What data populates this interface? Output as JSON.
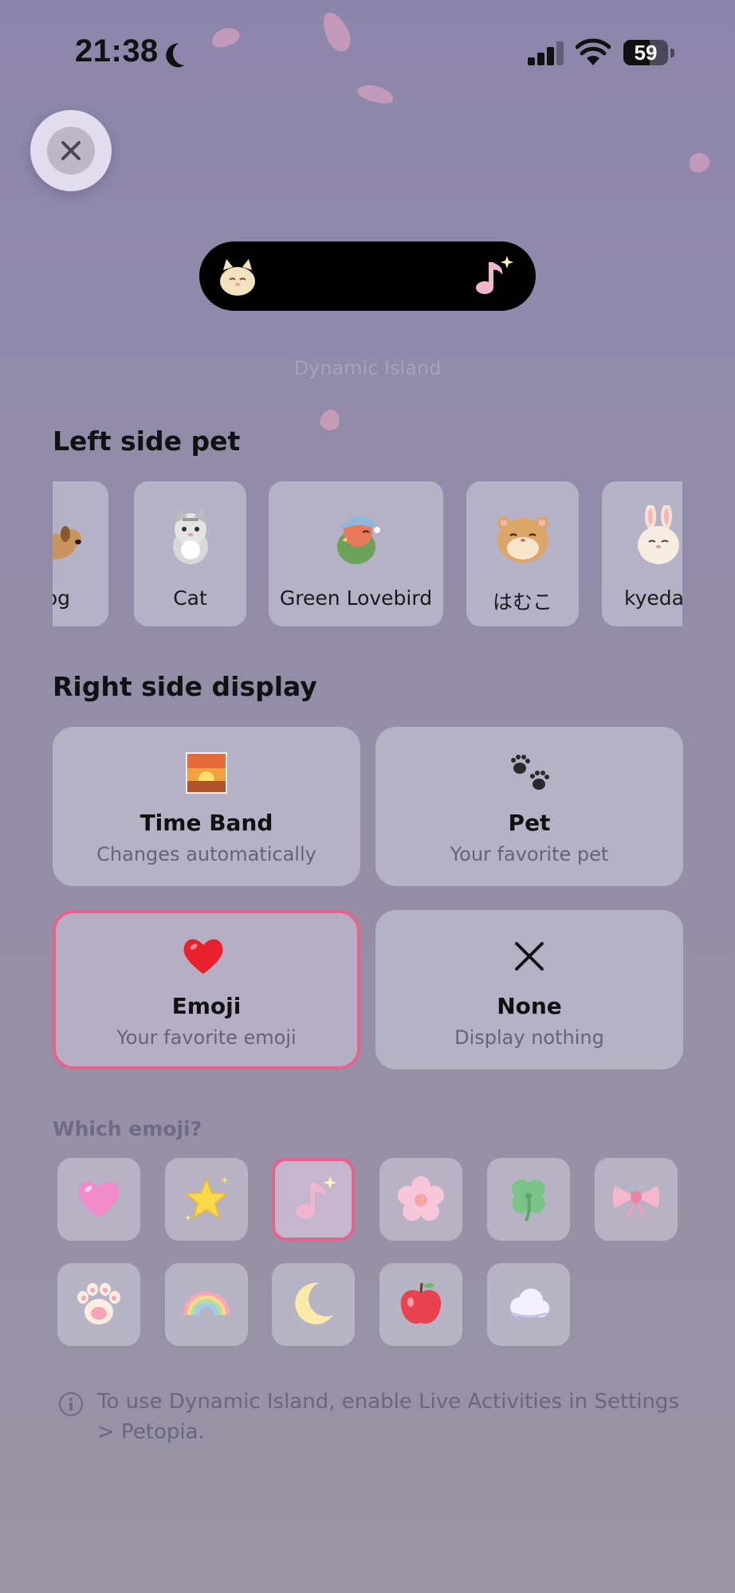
{
  "status_bar": {
    "time": "21:38",
    "battery": "59",
    "battery_level": 0.59,
    "icons": [
      "moon-icon",
      "signal-icon",
      "wifi-icon",
      "battery-icon"
    ]
  },
  "close_button": {
    "icon": "close-icon"
  },
  "island": {
    "caption": "Dynamic Island",
    "left_icon": "cat-pet-icon",
    "right_icon": "music-note-icon"
  },
  "left_side": {
    "title": "Left side pet",
    "pets": [
      {
        "label": "og",
        "icon": "dog-pet-icon"
      },
      {
        "label": "Cat",
        "icon": "cat-pet-icon"
      },
      {
        "label": "Green Lovebird",
        "icon": "lovebird-pet-icon"
      },
      {
        "label": "はむこ",
        "icon": "hamster-pet-icon"
      },
      {
        "label": "kyedac",
        "icon": "bunny-pet-icon"
      }
    ]
  },
  "right_side": {
    "title": "Right side display",
    "options": [
      {
        "title": "Time Band",
        "subtitle": "Changes automatically",
        "icon": "sunrise-icon",
        "selected": false
      },
      {
        "title": "Pet",
        "subtitle": "Your favorite pet",
        "icon": "paw-prints-icon",
        "selected": false
      },
      {
        "title": "Emoji",
        "subtitle": "Your favorite emoji",
        "icon": "heart-icon",
        "selected": true
      },
      {
        "title": "None",
        "subtitle": "Display nothing",
        "icon": "x-icon",
        "selected": false
      }
    ]
  },
  "emoji_picker": {
    "label": "Which emoji?",
    "emojis": [
      {
        "icon": "pink-heart-icon",
        "selected": false
      },
      {
        "icon": "star-icon",
        "selected": false
      },
      {
        "icon": "music-note-icon",
        "selected": true
      },
      {
        "icon": "cherry-blossom-icon",
        "selected": false
      },
      {
        "icon": "clover-icon",
        "selected": false
      },
      {
        "icon": "ribbon-icon",
        "selected": false
      },
      {
        "icon": "paw-icon",
        "selected": false
      },
      {
        "icon": "rainbow-icon",
        "selected": false
      },
      {
        "icon": "crescent-moon-icon",
        "selected": false
      },
      {
        "icon": "apple-icon",
        "selected": false
      },
      {
        "icon": "cloud-icon",
        "selected": false
      }
    ]
  },
  "info": {
    "icon": "info-icon",
    "text": "To use Dynamic Island, enable Live Activities in Settings > Petopia."
  },
  "colors": {
    "accent": "#e8628f",
    "background": "#928ca9",
    "card": "#d2cfde"
  }
}
